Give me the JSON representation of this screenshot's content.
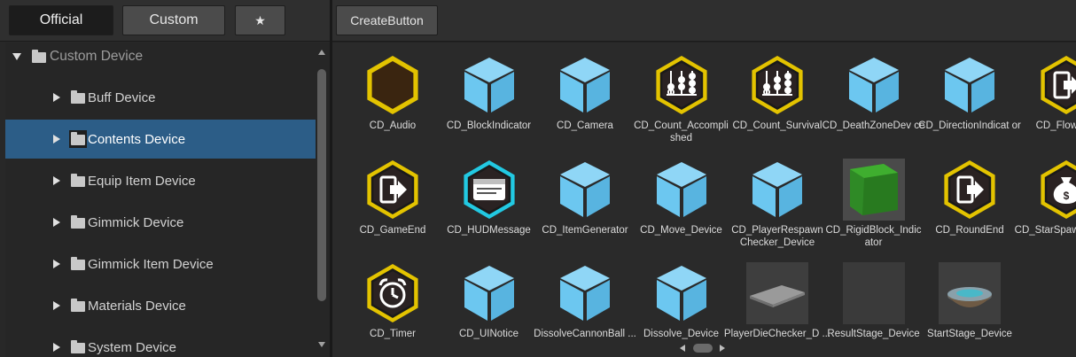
{
  "left_toolbar": {
    "official_label": "Official",
    "custom_label": "Custom",
    "favorites_label": "★"
  },
  "right_toolbar": {
    "create_label": "CreateButton"
  },
  "tree": {
    "root_label": "Custom Device",
    "items": [
      {
        "label": "Buff Device"
      },
      {
        "label": "Contents Device",
        "selected": true
      },
      {
        "label": "Equip Item Device"
      },
      {
        "label": "Gimmick Device"
      },
      {
        "label": "Gimmick Item Device"
      },
      {
        "label": "Materials Device"
      },
      {
        "label": "System Device"
      }
    ]
  },
  "colors": {
    "selection": "#2c5d87",
    "gold_badge": "#e3c300",
    "cyan_badge": "#22c9e2",
    "cube": "#6cc7f0"
  },
  "grid": {
    "items": [
      {
        "label": "CD_Audio",
        "icon": "hexagon-badge-icon"
      },
      {
        "label": "CD_BlockIndicator",
        "icon": "cube-icon"
      },
      {
        "label": "CD_Camera",
        "icon": "cube-icon"
      },
      {
        "label": "CD_Count_Accompli shed",
        "icon": "abacus-badge-icon"
      },
      {
        "label": "CD_Count_Survival",
        "icon": "abacus-badge-icon"
      },
      {
        "label": "CD_DeathZoneDev ce",
        "icon": "cube-icon"
      },
      {
        "label": "CD_DirectionIndicat or",
        "icon": "cube-icon"
      },
      {
        "label": "CD_FlowEnd",
        "icon": "exit-badge-icon"
      },
      {
        "label": "CD_GameEnd",
        "icon": "exit-badge-icon"
      },
      {
        "label": "CD_HUDMessage",
        "icon": "message-badge-icon"
      },
      {
        "label": "CD_ItemGenerator",
        "icon": "cube-icon"
      },
      {
        "label": "CD_Move_Device",
        "icon": "cube-icon"
      },
      {
        "label": "CD_PlayerRespawn Checker_Device",
        "icon": "cube-icon"
      },
      {
        "label": "CD_RigidBlock_Indic ator",
        "icon": "green-block-thumbnail"
      },
      {
        "label": "CD_RoundEnd",
        "icon": "exit-badge-icon"
      },
      {
        "label": "CD_StarSpawn_De ce",
        "icon": "money-bag-badge-icon"
      },
      {
        "label": "CD_Timer",
        "icon": "alarm-clock-badge-icon"
      },
      {
        "label": "CD_UINotice",
        "icon": "cube-icon"
      },
      {
        "label": "DissolveCannonBall ...",
        "icon": "cube-icon"
      },
      {
        "label": "Dissolve_Device",
        "icon": "cube-icon"
      },
      {
        "label": "PlayerDieChecker_D ...",
        "icon": "grey-plate-thumbnail"
      },
      {
        "label": "ResultStage_Device",
        "icon": "grey-box-thumbnail"
      },
      {
        "label": "StartStage_Device",
        "icon": "round-platform-thumbnail"
      }
    ]
  }
}
